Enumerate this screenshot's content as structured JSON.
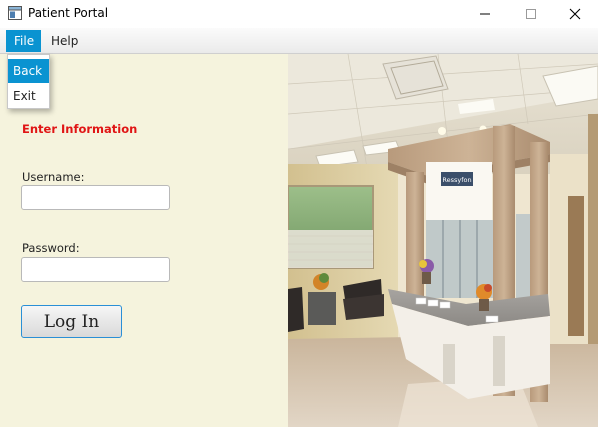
{
  "window": {
    "title": "Patient Portal"
  },
  "menubar": {
    "items": [
      {
        "label": "File"
      },
      {
        "label": "Help"
      }
    ]
  },
  "file_menu": {
    "items": [
      {
        "label": "Back"
      },
      {
        "label": "Exit"
      }
    ]
  },
  "form": {
    "heading": "Enter Information",
    "username_label": "Username:",
    "username_value": "",
    "password_label": "Password:",
    "password_value": "",
    "login_label": "Log In"
  },
  "photo": {
    "sign_text": "Ressyfon"
  },
  "colors": {
    "accent": "#0a93d1",
    "heading": "#e01515",
    "panel_bg": "#f5f3dd"
  }
}
